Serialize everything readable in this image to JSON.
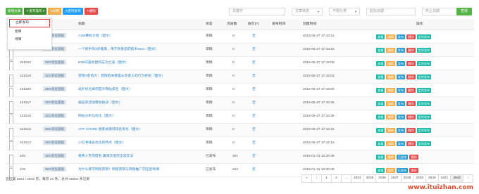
{
  "toolbar": {
    "new": "新增文章",
    "publish": "发布操作",
    "refresh": "刷新",
    "timed": "定时发布",
    "delete": "删除"
  },
  "filters": {
    "keyword_placeholder": "关键字",
    "status_select": "文章状态",
    "category_select": "不限分类",
    "start_date_placeholder": "起始日期",
    "end_date_placeholder": "终止日期",
    "search_button": "查找"
  },
  "dropdown": {
    "items": [
      "立即发布",
      "招审",
      "待审"
    ]
  },
  "table": {
    "headers": {
      "title": "标题",
      "status": "状态",
      "views": "浏览数",
      "indexed": "收引(?)",
      "publish_time": "发布时间",
      "created_time": "创建时间",
      "ops": "操作"
    },
    "rows": [
      {
        "id": "",
        "tag": "SEO优化基础",
        "title": "ASM黄松介绍（图文）",
        "status": "草稿",
        "views": "0",
        "indexed": "否",
        "publish_time": "",
        "created": "2019-05-27 17:43:21"
      },
      {
        "id": "",
        "tag": "SEO优化基础",
        "title": "一个新手的3步框架，用于改善您的技术SEO（图文）",
        "status": "草稿",
        "views": "0",
        "indexed": "否",
        "publish_time": "",
        "created": "2019-05-27 17:43:16"
      },
      {
        "id": "101522",
        "tag": "SEO优化基础",
        "title": "B2B内容创建的成功之道（图文）",
        "status": "草稿",
        "views": "0",
        "indexed": "否",
        "publish_time": "",
        "created": "2019-05-27 17:43:09"
      },
      {
        "id": "101519",
        "tag": "SEO优化基础",
        "title": "营销Y影响力：营销的关键是从改变人的行为开始（图文）",
        "status": "草稿",
        "views": "0",
        "indexed": "否",
        "publish_time": "",
        "created": "2019-05-27 17:43:03"
      },
      {
        "id": "101520",
        "tag": "SEO优化基础",
        "title": "站外优化如何提升网站排名（图文）",
        "status": "草稿",
        "views": "0",
        "indexed": "否",
        "publish_time": "",
        "created": "2019-05-27 17:43:00"
      },
      {
        "id": "101517",
        "tag": "SEO优化基础",
        "title": "痛狂的活动策划秘诀（图文）",
        "status": "草稿",
        "views": "0",
        "indexed": "否",
        "publish_time": "",
        "created": "2019-05-27 17:42:46"
      },
      {
        "id": "101516",
        "tag": "SEO优化基础",
        "title": "网站分析与优化（图文）",
        "status": "草稿",
        "views": "0",
        "indexed": "否",
        "publish_time": "",
        "created": "2019-05-27 17:42:39"
      },
      {
        "id": "101515",
        "tag": "SEO优化基础",
        "title": "APP STORE 搜索关键词排名优化（图文）",
        "status": "草稿",
        "views": "0",
        "indexed": "否",
        "publish_time": "",
        "created": "2019-05-27 17:42:16"
      },
      {
        "id": "101513",
        "tag": "SEO优化基础",
        "title": "小红书排名优化的特点（图文）",
        "status": "草稿",
        "views": "0",
        "indexed": "否",
        "publish_time": "",
        "created": "2019-05-27 17:42:13"
      },
      {
        "id": "445",
        "tag": "SEO优化基础",
        "title": "耗秀人告刘提名,魔鬼交谊完全成交法",
        "status": "已发布",
        "views": "301",
        "indexed": "否",
        "publish_time": "",
        "created": "2018-01-31 10:30:49"
      },
      {
        "id": "449",
        "tag": "SEO优化基础",
        "title": "为什么要学网络营销？网络营销与网络推广的区别到哪",
        "status": "已发布",
        "views": "222",
        "indexed": "否",
        "publish_time": "",
        "created": "2018-01-31 10:30:49"
      }
    ],
    "ops_draft": [
      "查看",
      "编辑",
      "发布",
      "删除",
      "定时发布"
    ],
    "ops_published": [
      "查看",
      "编辑",
      "已发布",
      "删除"
    ]
  },
  "footer": {
    "summary": "显示第 2842 / 2842 页，每页 20 条，总共 56831 条记录"
  },
  "pager": [
    "«",
    "‹",
    "1",
    "2",
    "...",
    "2834",
    "2835",
    "2836",
    "2837",
    "2838",
    "2839",
    "2840",
    "2841",
    "2842",
    "›"
  ],
  "watermark": "www.ituizhan.com"
}
